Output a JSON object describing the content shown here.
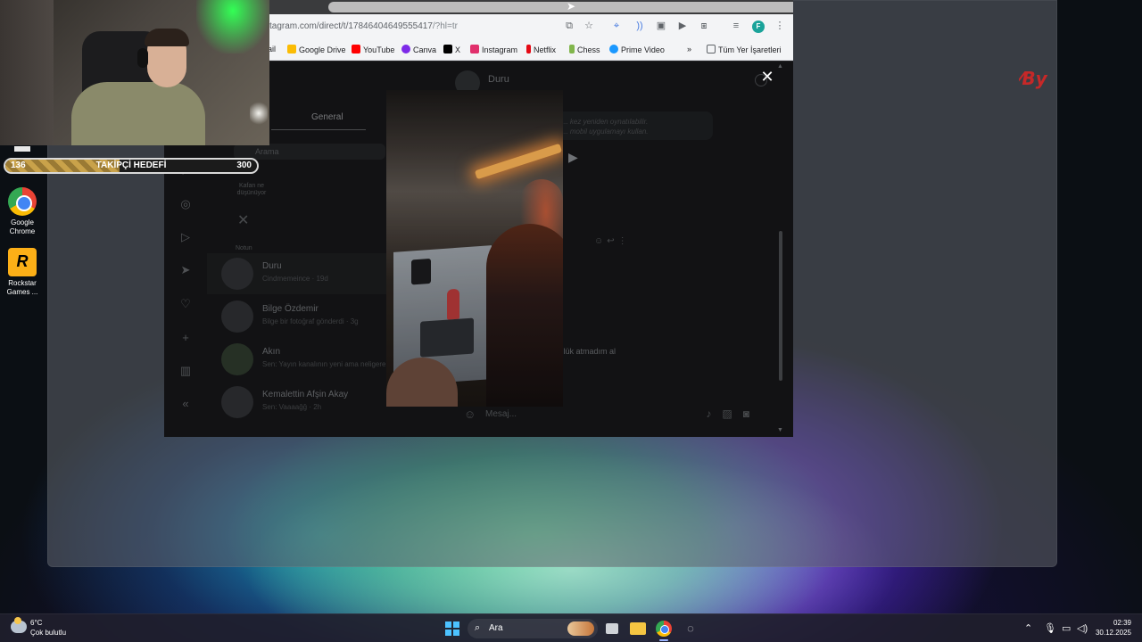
{
  "browser": {
    "url_main": "tagram.com/direct/t/17846404649555417",
    "url_query": "/?hl=tr",
    "bookmarks": [
      {
        "label": "ail",
        "color": "#c5221f"
      },
      {
        "label": "Google Drive",
        "color": "#fbbc04"
      },
      {
        "label": "YouTube",
        "color": "#ff0000"
      },
      {
        "label": "Canva",
        "color": "#7d2ae8"
      },
      {
        "label": "X",
        "color": "#000000"
      },
      {
        "label": "Instagram",
        "color": "#e1306c"
      },
      {
        "label": "Netflix",
        "color": "#e50914"
      },
      {
        "label": "Chess",
        "color": "#81b64c"
      },
      {
        "label": "Prime Video",
        "color": "#1a98ff"
      }
    ],
    "bookmarks_overflow": "»",
    "all_bookmarks": "Tüm Yer İşaretleri",
    "profile_initial": "F"
  },
  "instagram": {
    "tab_general": "General",
    "search_placeholder": "Arama",
    "note_text": "Kafan ne düşünüyor",
    "notes_label": "Notun",
    "chats": [
      {
        "name": "Duru",
        "preview": "Cindmemeince · 19d"
      },
      {
        "name": "Bilge Özdemir",
        "preview": "Bilge bir fotoğraf gönderdi · 3g"
      },
      {
        "name": "Akın",
        "preview": "Sen: Yayın kanalının yeni ama neligere"
      },
      {
        "name": "Kemalettin Afşin Akay",
        "preview": "Sen: Vaaaağğ · 2h"
      }
    ],
    "conversation_name": "Duru",
    "banner_line1": "... kez yeniden oynatılabilir.",
    "banner_line2": "... mobil uygulamayı kullan.",
    "message_text": "mlük atmadım al",
    "composer_placeholder": "Mesaj..."
  },
  "overlay": {
    "follower_current": "136",
    "follower_label": "TAKİPÇİ HEDEFİ",
    "follower_target": "300",
    "follower_progress": 0.453
  },
  "desktop": {
    "icons": [
      {
        "label": "Google Chrome"
      },
      {
        "label": "Rockstar Games ..."
      }
    ],
    "brand_text": "By"
  },
  "taskbar": {
    "weather_temp": "6°C",
    "weather_desc": "Çok bulutlu",
    "search_label": "Ara",
    "time": "02:39",
    "date": "30.12.2025"
  }
}
